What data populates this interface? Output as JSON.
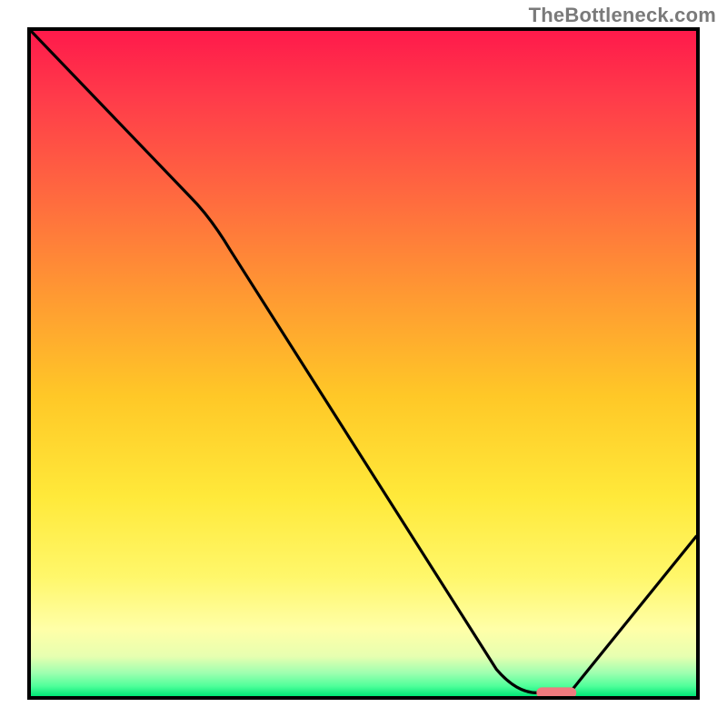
{
  "watermark": "TheBottleneck.com",
  "domain": "Chart",
  "chart_data": {
    "type": "line",
    "title": "",
    "xlabel": "",
    "ylabel": "",
    "xlim": [
      0,
      100
    ],
    "ylim": [
      0,
      100
    ],
    "series": [
      {
        "name": "bottleneck-curve",
        "x": [
          0,
          25,
          72,
          76,
          81,
          100
        ],
        "y": [
          100,
          74,
          2,
          0,
          0,
          24
        ]
      }
    ],
    "marker": {
      "name": "optimal-range",
      "x_range": [
        76,
        82
      ],
      "y": 0.5
    },
    "background_gradient": {
      "stops": [
        {
          "offset": 0,
          "color": "#ff1a4b"
        },
        {
          "offset": 0.1,
          "color": "#ff3b4a"
        },
        {
          "offset": 0.25,
          "color": "#ff6a3f"
        },
        {
          "offset": 0.4,
          "color": "#ff9a32"
        },
        {
          "offset": 0.55,
          "color": "#ffc827"
        },
        {
          "offset": 0.7,
          "color": "#ffe93a"
        },
        {
          "offset": 0.82,
          "color": "#fff76a"
        },
        {
          "offset": 0.9,
          "color": "#ffffa8"
        },
        {
          "offset": 0.94,
          "color": "#e7ffb0"
        },
        {
          "offset": 0.965,
          "color": "#9fffb0"
        },
        {
          "offset": 0.985,
          "color": "#4fff9a"
        },
        {
          "offset": 1.0,
          "color": "#00e676"
        }
      ]
    }
  }
}
